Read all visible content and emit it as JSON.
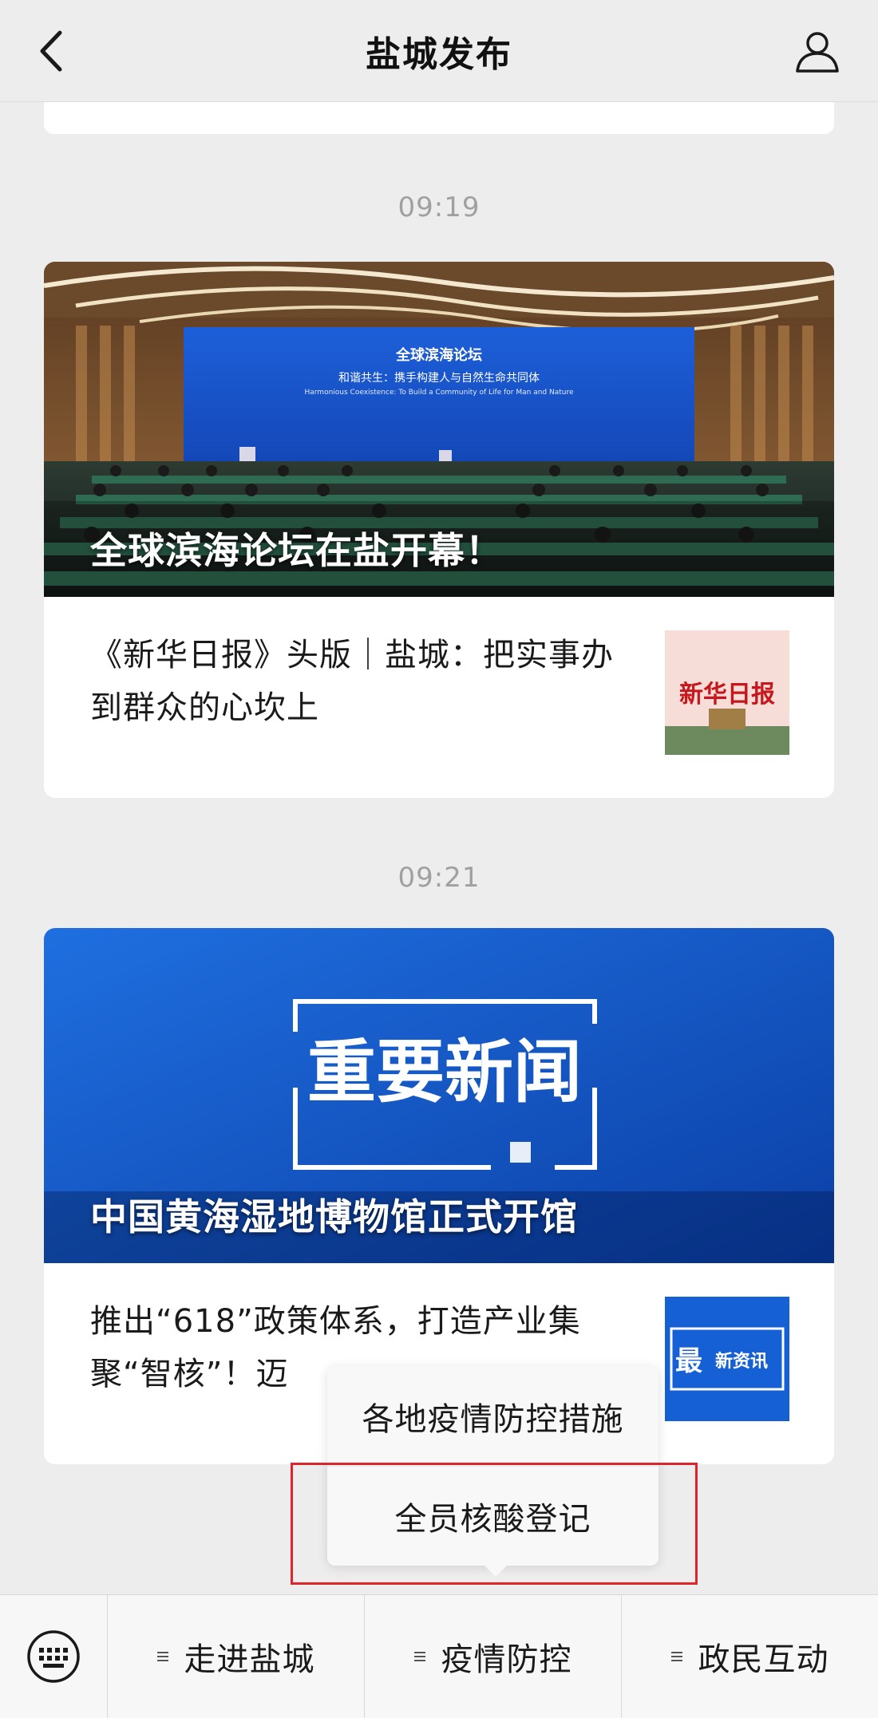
{
  "app": {
    "title": "盐城发布"
  },
  "icons": {
    "back": "chevron-left-icon",
    "profile": "person-icon",
    "keyboard": "keyboard-icon",
    "menu": "menu-lines-icon"
  },
  "colors": {
    "background": "#ededed",
    "card": "#ffffff",
    "timestamp": "#a0a0a0",
    "highlight": "#e0242b"
  },
  "messages": [
    {
      "time": "09:19",
      "cover_title": "全球滨海论坛在盐开幕！",
      "cover_screen_title": "全球滨海论坛",
      "cover_screen_sub": "和谐共生：携手构建人与自然生命共同体",
      "cover_screen_en": "Harmonious Coexistence: To Build a Community of Life for Man and Nature",
      "sub_title": "《新华日报》头版｜盐城：把实事办到群众的心坎上",
      "thumb_text": "新华日报"
    },
    {
      "time": "09:21",
      "cover_title": "中国黄海湿地博物馆正式开馆",
      "cover_banner": "重要新闻",
      "sub_title": "推出“618”政策体系，打造产业集聚“智核”！迈",
      "thumb_text_big": "最",
      "thumb_text": "新资讯"
    }
  ],
  "popup": {
    "items": [
      "各地疫情防控措施",
      "全员核酸登记"
    ]
  },
  "menubar": {
    "items": [
      "走进盐城",
      "疫情防控",
      "政民互动"
    ]
  }
}
